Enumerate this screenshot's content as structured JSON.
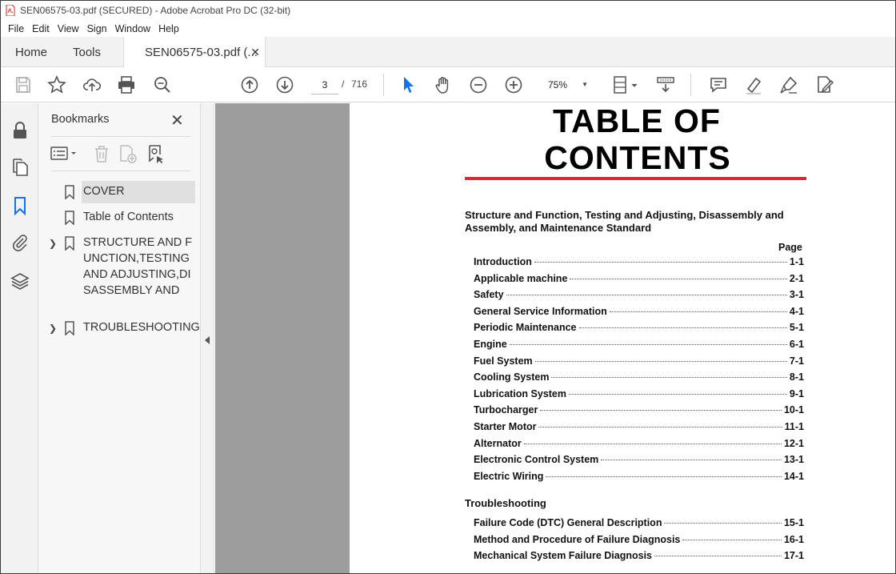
{
  "window": {
    "title": "SEN06575-03.pdf (SECURED) - Adobe Acrobat Pro DC (32-bit)",
    "icon": "acrobat-pdf-icon"
  },
  "menu": [
    "File",
    "Edit",
    "View",
    "Sign",
    "Window",
    "Help"
  ],
  "tabs": {
    "home": "Home",
    "tools": "Tools",
    "document": "SEN06575-03.pdf (...",
    "close_glyph": "✕"
  },
  "toolbar": {
    "current_page": "3",
    "page_separator": "/",
    "total_pages": "716",
    "zoom": "75%",
    "icons": [
      "save-icon",
      "bookmark-star-icon",
      "upload-cloud-icon",
      "print-icon",
      "zoom-search-icon",
      "page-up-icon",
      "page-down-icon",
      "select-arrow-icon",
      "hand-icon",
      "zoom-out-icon",
      "zoom-in-icon",
      "page-fit-icon",
      "scroll-mode-icon",
      "comment-icon",
      "highlight-icon",
      "sign-icon",
      "edit-pdf-icon"
    ]
  },
  "left_rail": [
    "lock-icon",
    "pages-icon",
    "bookmark-icon",
    "attachment-icon",
    "layers-icon"
  ],
  "bookmarks_panel": {
    "title": "Bookmarks",
    "close_glyph": "✕",
    "items": [
      {
        "label": "COVER",
        "expandable": false,
        "selected": true
      },
      {
        "label": "Table of Contents",
        "expandable": false,
        "selected": false
      },
      {
        "label": "STRUCTURE AND FUNCTION,TESTING AND ADJUSTING,DISASSEMBLY AND",
        "expandable": true,
        "selected": false
      },
      {
        "label": "TROUBLESHOOTING",
        "expandable": true,
        "selected": false
      }
    ]
  },
  "document": {
    "title_line1": "TABLE OF",
    "title_line2": "CONTENTS",
    "accent_color": "#e0263c",
    "section1_title": "Structure and Function, Testing and Adjusting, Disassembly and Assembly, and Maintenance Standard",
    "page_header": "Page",
    "section1_entries": [
      {
        "name": "Introduction",
        "page": "1-1"
      },
      {
        "name": "Applicable machine",
        "page": "2-1"
      },
      {
        "name": "Safety",
        "page": "3-1"
      },
      {
        "name": "General Service Information",
        "page": "4-1"
      },
      {
        "name": "Periodic Maintenance",
        "page": "5-1"
      },
      {
        "name": "Engine",
        "page": "6-1"
      },
      {
        "name": "Fuel System",
        "page": "7-1"
      },
      {
        "name": "Cooling System",
        "page": "8-1"
      },
      {
        "name": "Lubrication System",
        "page": "9-1"
      },
      {
        "name": "Turbocharger",
        "page": "10-1"
      },
      {
        "name": "Starter Motor",
        "page": "11-1"
      },
      {
        "name": "Alternator",
        "page": "12-1"
      },
      {
        "name": "Electronic Control System",
        "page": "13-1"
      },
      {
        "name": "Electric Wiring",
        "page": "14-1"
      }
    ],
    "section2_title": "Troubleshooting",
    "section2_entries": [
      {
        "name": "Failure Code (DTC) General Description",
        "page": "15-1"
      },
      {
        "name": "Method and Procedure of Failure Diagnosis",
        "page": "16-1"
      },
      {
        "name": "Mechanical System Failure Diagnosis",
        "page": "17-1"
      }
    ]
  }
}
